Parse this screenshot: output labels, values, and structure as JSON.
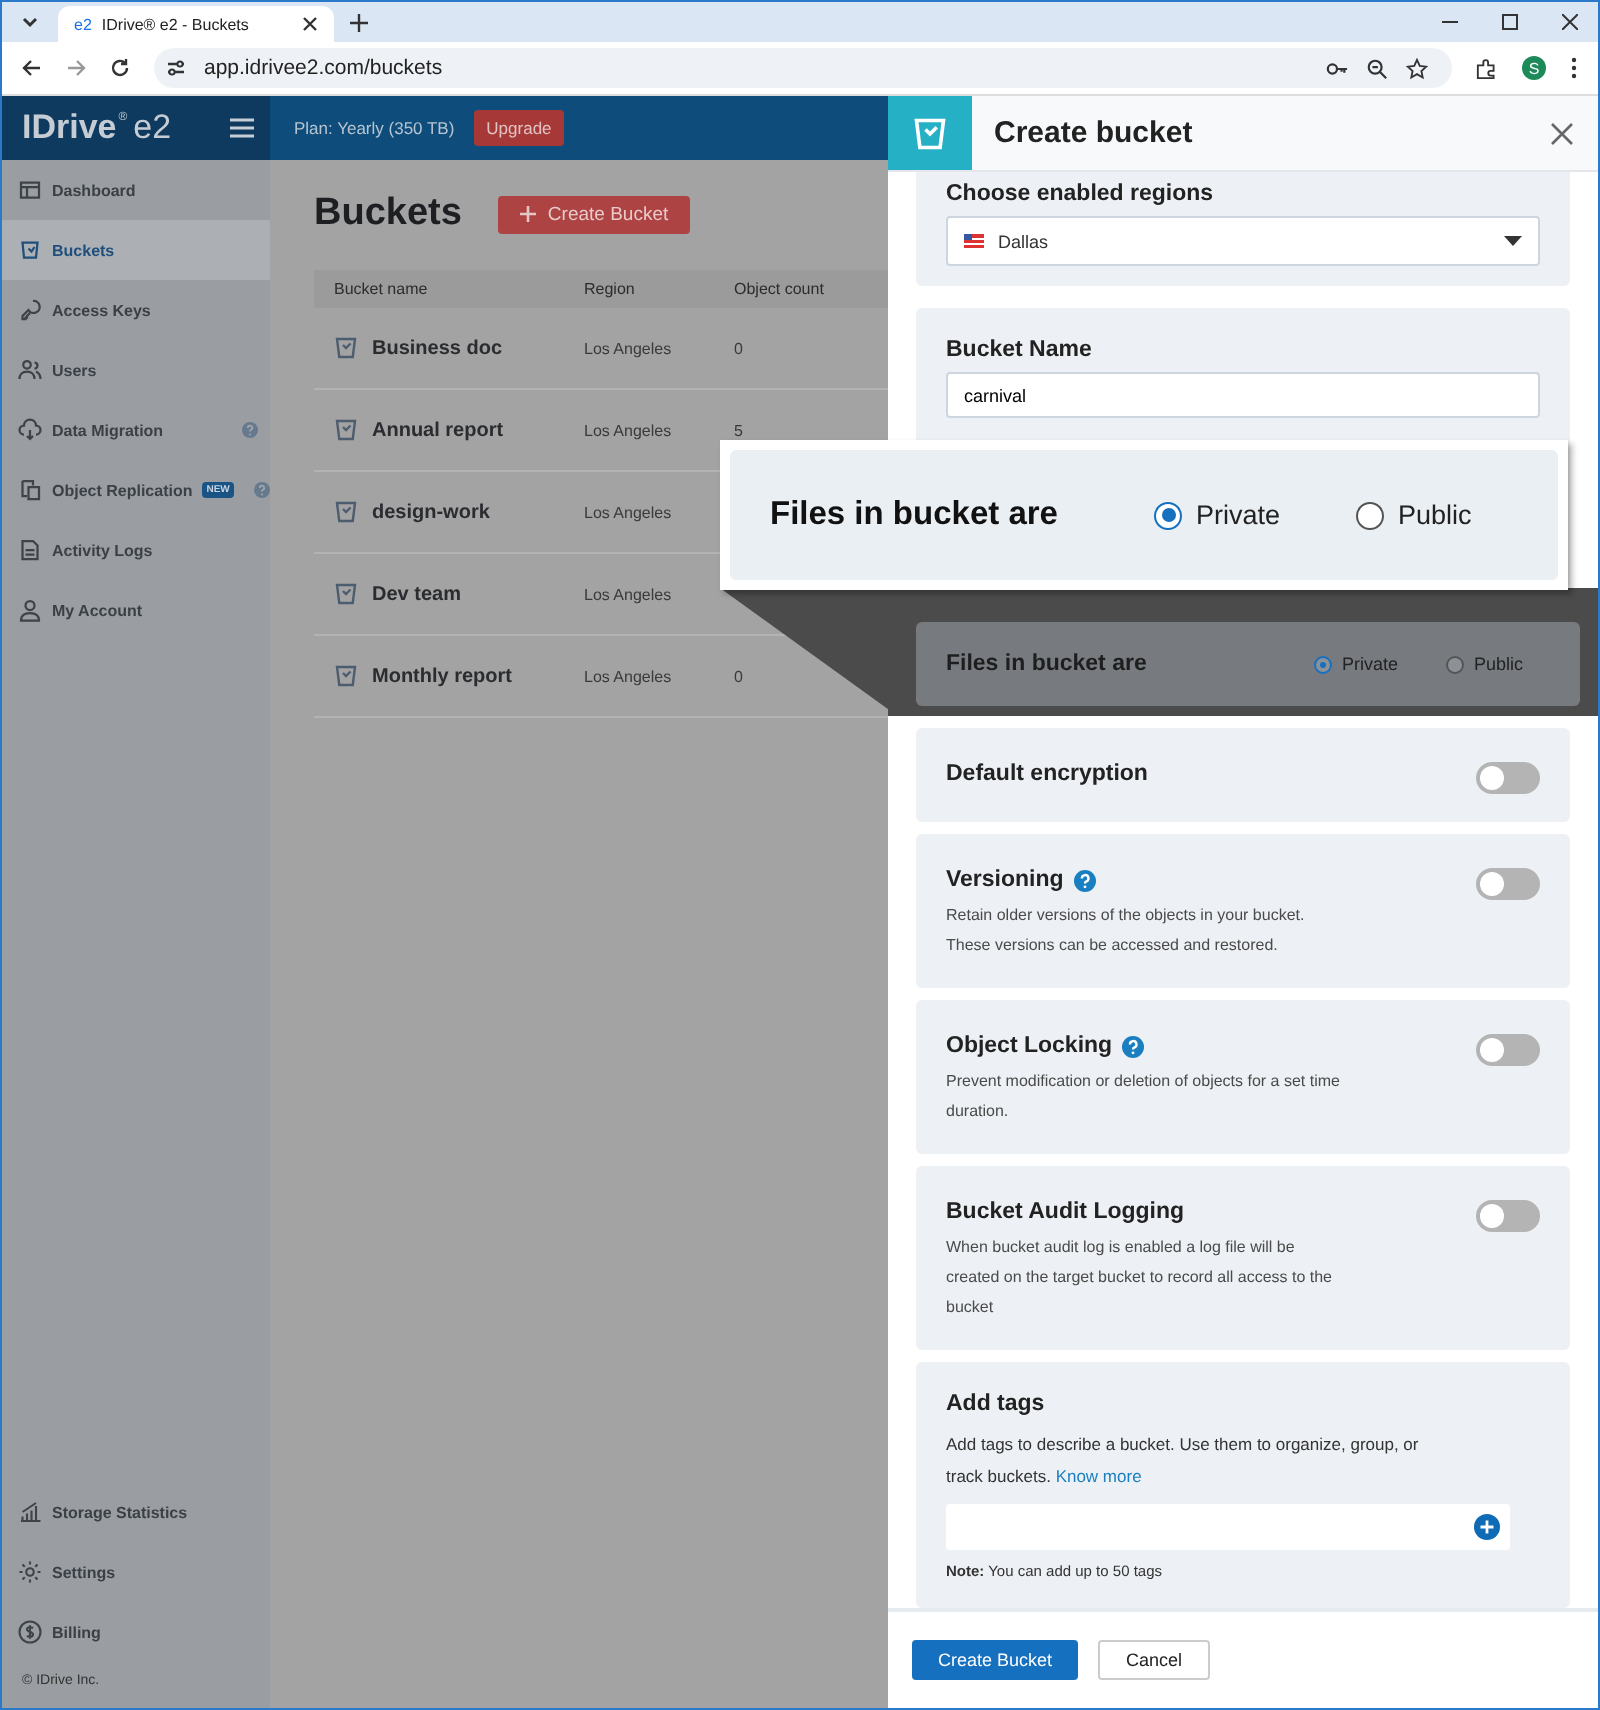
{
  "browser": {
    "favicon": "e2",
    "tab_title": "IDrive® e2 - Buckets",
    "url": "app.idrivee2.com/buckets",
    "profile_initial": "S"
  },
  "logo": {
    "brand": "IDrive",
    "mark": "®",
    "product": "e2"
  },
  "plan": "Plan: Yearly (350 TB)",
  "upgrade": "Upgrade",
  "sidebar": {
    "items": [
      {
        "label": "Dashboard",
        "selected": false
      },
      {
        "label": "Buckets",
        "selected": true
      },
      {
        "label": "Access Keys",
        "selected": false
      },
      {
        "label": "Users",
        "selected": false
      },
      {
        "label": "Data Migration",
        "selected": false,
        "help": true
      },
      {
        "label": "Object Replication",
        "selected": false,
        "badge": "NEW",
        "help": true
      },
      {
        "label": "Activity Logs",
        "selected": false
      },
      {
        "label": "My Account",
        "selected": false
      }
    ],
    "bottom_items": [
      {
        "label": "Storage Statistics",
        "selected": false
      },
      {
        "label": "Settings",
        "selected": false
      },
      {
        "label": "Billing",
        "selected": false
      }
    ],
    "footer": "© IDrive Inc."
  },
  "main": {
    "title": "Buckets",
    "create_button": "Create Bucket",
    "table": {
      "columns": [
        "Bucket name",
        "Region",
        "Object count"
      ],
      "rows": [
        {
          "name": "Business doc",
          "region": "Los Angeles",
          "count": "0"
        },
        {
          "name": "Annual report",
          "region": "Los Angeles",
          "count": "5"
        },
        {
          "name": "design-work",
          "region": "Los Angeles"
        },
        {
          "name": "Dev team",
          "region": "Los Angeles"
        },
        {
          "name": "Monthly report",
          "region": "Los Angeles",
          "count": "0"
        }
      ]
    }
  },
  "panel": {
    "title": "Create bucket",
    "regions": {
      "label": "Choose enabled regions",
      "value": "Dallas"
    },
    "bucket_name": {
      "label": "Bucket Name",
      "value": "carnival"
    },
    "files": {
      "label": "Files in bucket are",
      "options": [
        {
          "label": "Private",
          "selected": true
        },
        {
          "label": "Public",
          "selected": false
        }
      ]
    },
    "toggles": [
      {
        "title": "Default encryption",
        "help": false,
        "on": false
      },
      {
        "title": "Versioning",
        "help": true,
        "description": "Retain older versions of the objects in your bucket. These versions can be accessed and restored.",
        "on": false
      },
      {
        "title": "Object Locking",
        "help": true,
        "description": "Prevent modification or deletion of objects for a set time duration.",
        "on": false
      },
      {
        "title": "Bucket Audit Logging",
        "help": false,
        "description": "When bucket audit log is enabled a log file will be created on the target bucket to record all access to the bucket",
        "on": false
      }
    ],
    "tags": {
      "title": "Add tags",
      "description": "Add tags to describe a bucket. Use them to organize, group, or track buckets.",
      "link": "Know more",
      "note": "**Note:** You can add up to 50 tags"
    },
    "buttons": {
      "primary": "Create Bucket",
      "cancel": "Cancel"
    }
  },
  "callout": {
    "label": "Files in bucket are",
    "options": [
      {
        "label": "Private",
        "selected": true
      },
      {
        "label": "Public",
        "selected": false
      }
    ]
  }
}
